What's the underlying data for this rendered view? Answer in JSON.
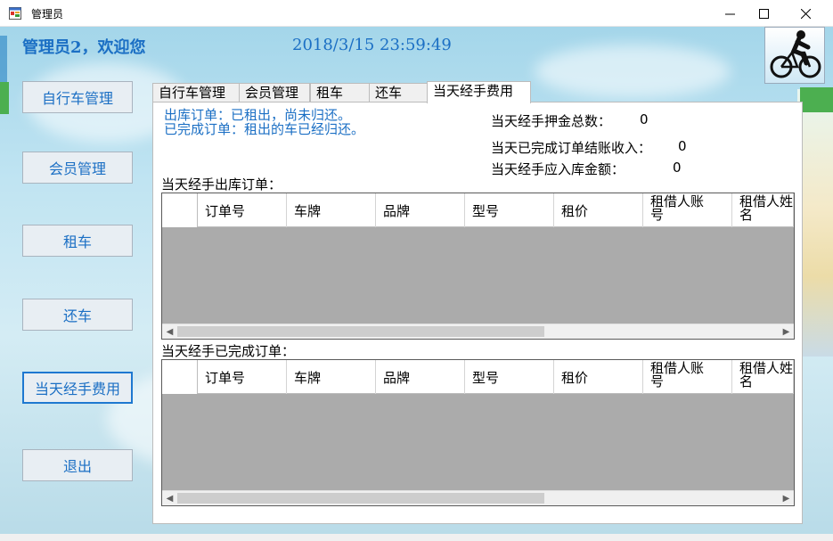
{
  "window": {
    "title": "管理员",
    "app_icon": "windows-form-icon",
    "controls": [
      "minimize-icon",
      "maximize-icon",
      "close-icon"
    ]
  },
  "header": {
    "welcome": "管理员2，欢迎您",
    "datetime": "2018/3/15  23:59:49",
    "logo": "cyclist-logo"
  },
  "nav": [
    {
      "label": "自行车管理"
    },
    {
      "label": "会员管理"
    },
    {
      "label": "租车"
    },
    {
      "label": "还车"
    },
    {
      "label": "当天经手费用",
      "active": true
    },
    {
      "label": "退出"
    }
  ],
  "tabs": [
    {
      "label": "自行车管理"
    },
    {
      "label": "会员管理"
    },
    {
      "label": "租车"
    },
    {
      "label": "还车"
    },
    {
      "label": "当天经手费用",
      "active": true
    }
  ],
  "legend": {
    "line1": "出库订单：已租出，尚未归还。",
    "line2": "已完成订单：租出的车已经归还。"
  },
  "stats": {
    "deposit_label": "当天经手押金总数：",
    "deposit_value": "0",
    "income_label": "当天已完成订单结账收入：",
    "income_value": "0",
    "due_label": "当天经手应入库金额：",
    "due_value": "0"
  },
  "outbound": {
    "title": "当天经手出库订单：",
    "columns": [
      "订单号",
      "车牌",
      "品牌",
      "型号",
      "租价",
      "租借人账号",
      "租借人姓名"
    ]
  },
  "completed": {
    "title": "当天经手已完成订单：",
    "columns": [
      "订单号",
      "车牌",
      "品牌",
      "型号",
      "租价",
      "租借人账号",
      "租借人姓名"
    ]
  },
  "colors": {
    "accent": "#1b6fc4",
    "grid_empty": "#ababab"
  }
}
